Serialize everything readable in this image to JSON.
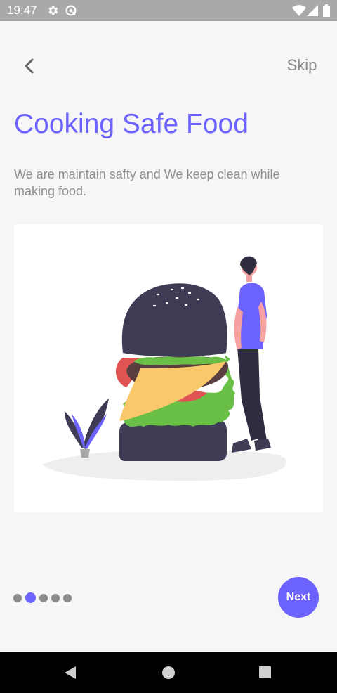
{
  "status_bar": {
    "time": "19:47"
  },
  "header": {
    "back_icon": "chevron-left-icon",
    "skip_label": "Skip"
  },
  "onboarding": {
    "title": "Cooking Safe Food",
    "description": "We are maintain safty and We keep clean while making food.",
    "illustration": "burger-and-person-illustration"
  },
  "pager": {
    "total": 5,
    "active_index": 1
  },
  "next_label": "Next",
  "colors": {
    "accent": "#6c63ff",
    "skip_text": "#8a8a8a",
    "body_text": "#8f8f8f",
    "status_bar": "#a9a9a9",
    "background": "#f6f6f6"
  },
  "nav_bar": {
    "icons": [
      "nav-back-icon",
      "nav-home-icon",
      "nav-recent-icon"
    ]
  }
}
